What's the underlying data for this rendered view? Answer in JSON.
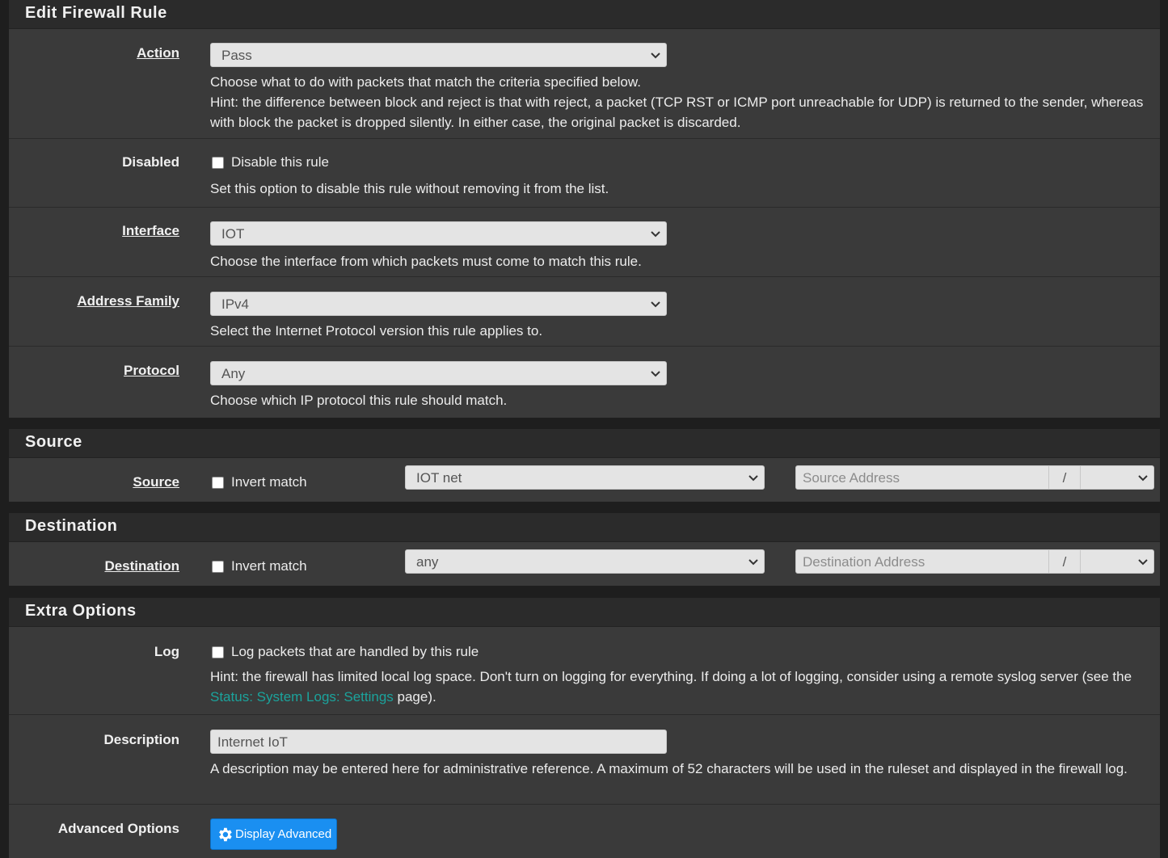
{
  "edit_rule": {
    "heading": "Edit Firewall Rule",
    "action": {
      "label": "Action",
      "value": "Pass",
      "help_1": "Choose what to do with packets that match the criteria specified below.",
      "help_2": "Hint: the difference between block and reject is that with reject, a packet (TCP RST or ICMP port unreachable for UDP) is returned to the sender, whereas with block the packet is dropped silently. In either case, the original packet is discarded."
    },
    "disabled": {
      "label": "Disabled",
      "checkbox_label": "Disable this rule",
      "checked": false,
      "help": "Set this option to disable this rule without removing it from the list."
    },
    "interface": {
      "label": "Interface",
      "value": "IOT",
      "help": "Choose the interface from which packets must come to match this rule."
    },
    "address_family": {
      "label": "Address Family",
      "value": "IPv4",
      "help": "Select the Internet Protocol version this rule applies to."
    },
    "protocol": {
      "label": "Protocol",
      "value": "Any",
      "help": "Choose which IP protocol this rule should match."
    }
  },
  "source": {
    "heading": "Source",
    "label": "Source",
    "invert_label": "Invert match",
    "invert_checked": false,
    "type_value": "IOT net",
    "address_placeholder": "Source Address",
    "slash": "/"
  },
  "destination": {
    "heading": "Destination",
    "label": "Destination",
    "invert_label": "Invert match",
    "invert_checked": false,
    "type_value": "any",
    "address_placeholder": "Destination Address",
    "slash": "/"
  },
  "extra": {
    "heading": "Extra Options",
    "log": {
      "label": "Log",
      "checkbox_label": "Log packets that are handled by this rule",
      "checked": false,
      "help_prefix": "Hint: the firewall has limited local log space. Don't turn on logging for everything. If doing a lot of logging, consider using a remote syslog server (see the ",
      "help_link": "Status: System Logs: Settings",
      "help_suffix": " page)."
    },
    "description": {
      "label": "Description",
      "value": "Internet IoT",
      "help": "A description may be entered here for administrative reference. A maximum of 52 characters will be used in the ruleset and displayed in the firewall log."
    },
    "advanced": {
      "label": "Advanced Options",
      "button_label": "Display Advanced",
      "button_icon": "gear-icon"
    }
  },
  "colors": {
    "panel_bg": "#3a3a3a",
    "heading_bg": "#2b2b2b",
    "link": "#1ba39c",
    "button": "#1a8ff1"
  }
}
